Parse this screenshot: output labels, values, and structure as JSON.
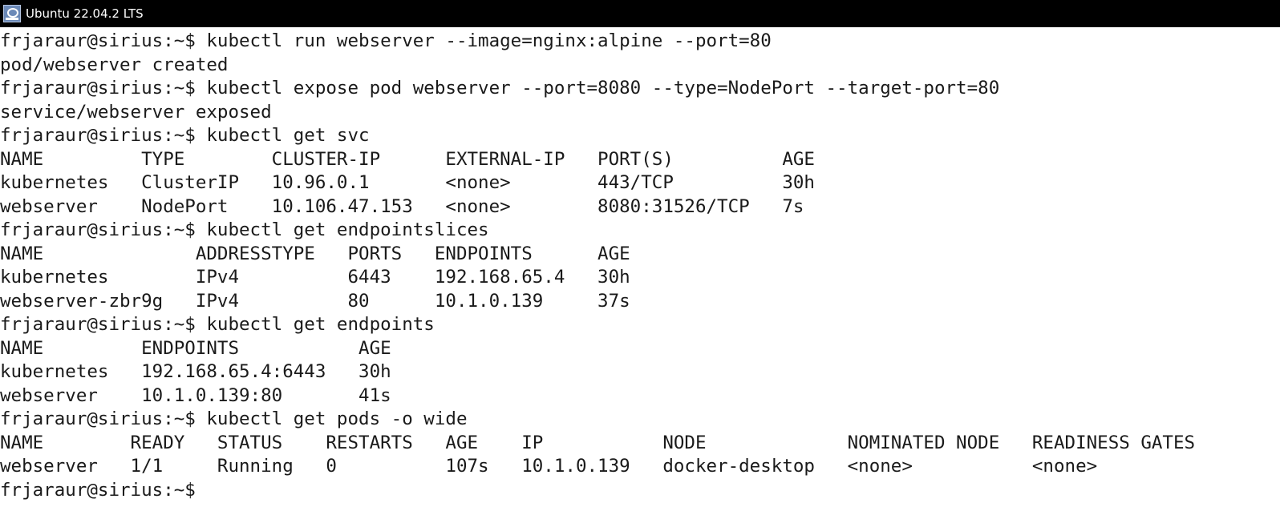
{
  "window": {
    "title": "Ubuntu 22.04.2 LTS",
    "icon": "ubuntu-terminal-icon"
  },
  "terminal": {
    "lines": [
      "frjaraur@sirius:~$ kubectl run webserver --image=nginx:alpine --port=80",
      "pod/webserver created",
      "frjaraur@sirius:~$ kubectl expose pod webserver --port=8080 --type=NodePort --target-port=80",
      "service/webserver exposed",
      "frjaraur@sirius:~$ kubectl get svc",
      "NAME         TYPE        CLUSTER-IP      EXTERNAL-IP   PORT(S)          AGE",
      "kubernetes   ClusterIP   10.96.0.1       <none>        443/TCP          30h",
      "webserver    NodePort    10.106.47.153   <none>        8080:31526/TCP   7s",
      "frjaraur@sirius:~$ kubectl get endpointslices",
      "NAME              ADDRESSTYPE   PORTS   ENDPOINTS      AGE",
      "kubernetes        IPv4          6443    192.168.65.4   30h",
      "webserver-zbr9g   IPv4          80      10.1.0.139     37s",
      "frjaraur@sirius:~$ kubectl get endpoints",
      "NAME         ENDPOINTS           AGE",
      "kubernetes   192.168.65.4:6443   30h",
      "webserver    10.1.0.139:80       41s",
      "frjaraur@sirius:~$ kubectl get pods -o wide",
      "NAME        READY   STATUS    RESTARTS   AGE    IP           NODE             NOMINATED NODE   READINESS GATES",
      "webserver   1/1     Running   0          107s   10.1.0.139   docker-desktop   <none>           <none>",
      "frjaraur@sirius:~$ "
    ]
  }
}
